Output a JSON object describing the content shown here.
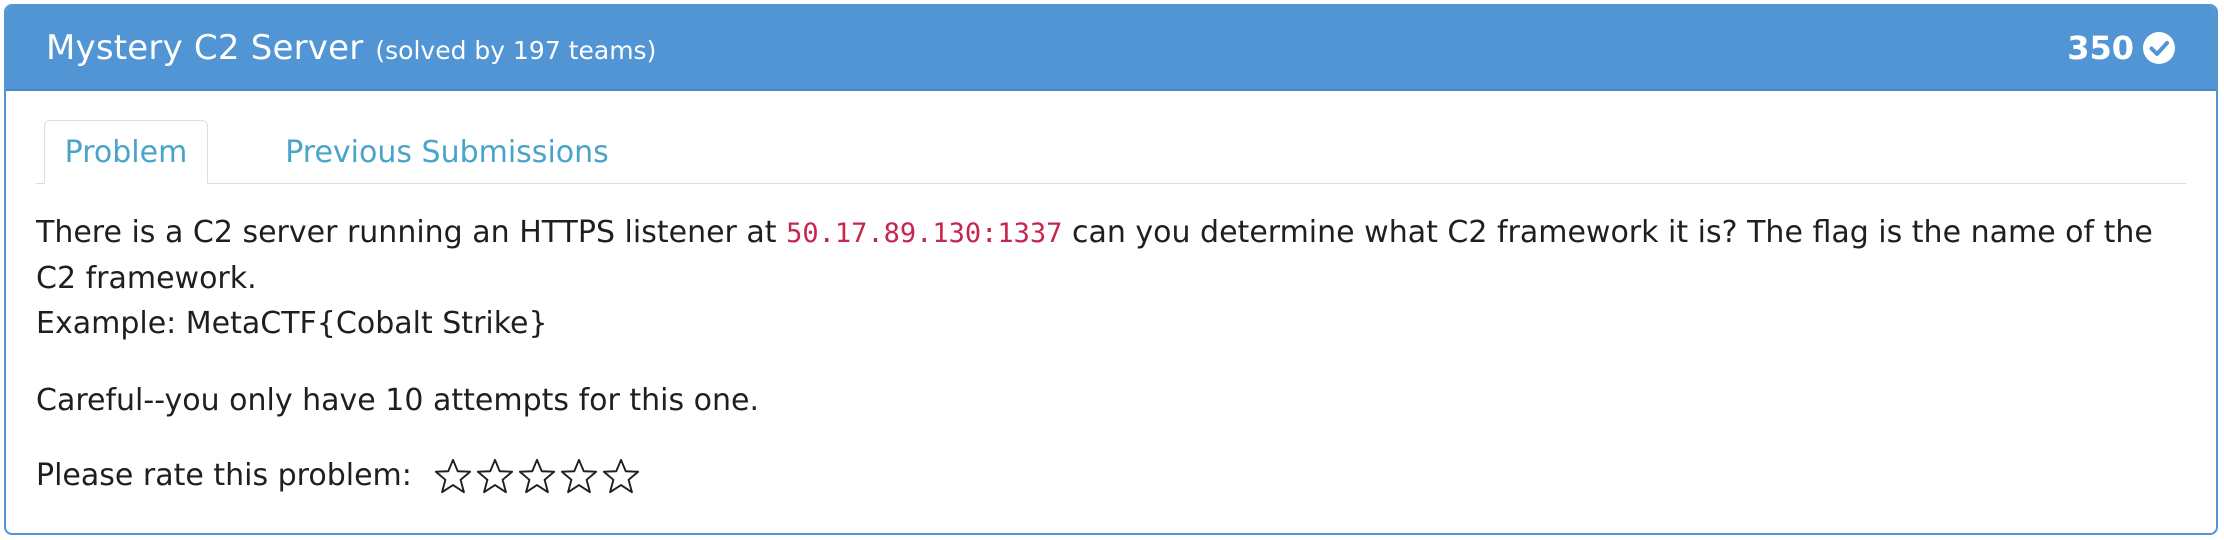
{
  "header": {
    "title": "Mystery C2 Server",
    "solved": "(solved by 197 teams)",
    "points": "350",
    "status_icon": "check-circle-icon"
  },
  "tabs": [
    {
      "label": "Problem",
      "active": true
    },
    {
      "label": "Previous Submissions",
      "active": false
    }
  ],
  "problem": {
    "line1_before": "There is a C2 server running an HTTPS listener at ",
    "address": "50.17.89.130:1337",
    "line1_after": " can you determine what C2 framework it is? The flag is the name of the C2 framework.",
    "example": "Example: MetaCTF{Cobalt Strike}",
    "warning": "Careful--you only have 10 attempts for this one."
  },
  "rating": {
    "label": "Please rate this problem:",
    "max_stars": 5,
    "current": 0,
    "icon": "star-outline-icon"
  },
  "colors": {
    "header_bg": "#5195d5",
    "tab_text": "#4aa3c9",
    "code_text": "#c7254e"
  }
}
